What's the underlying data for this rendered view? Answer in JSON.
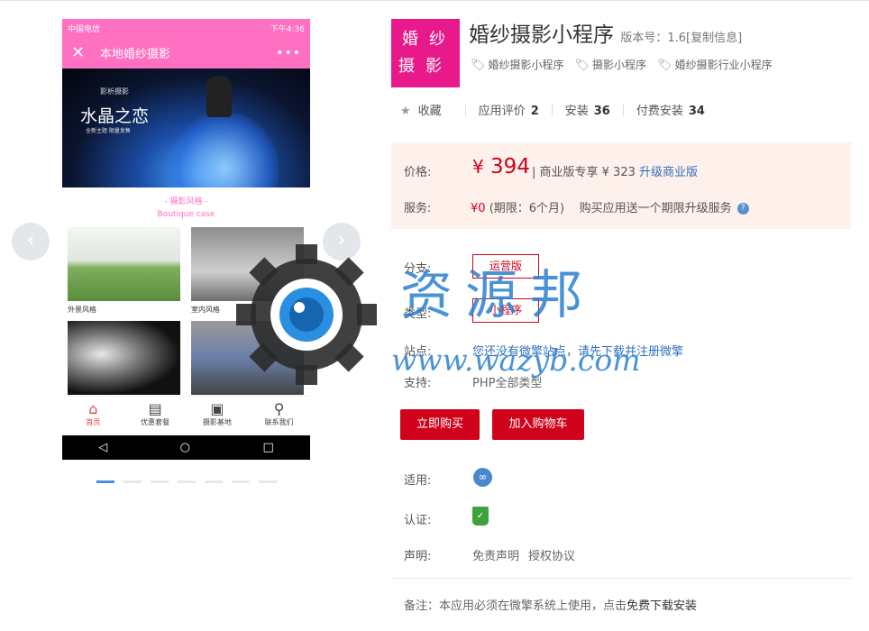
{
  "preview": {
    "status_left": "中国电信",
    "status_right": "下午4:36",
    "nav_title": "本地婚纱摄影",
    "more": "•••",
    "close": "✕",
    "banner_brand": "影析摄影",
    "banner_title": "水晶之恋",
    "banner_sub": "全新主题 限量发售",
    "section_cn": "- 摄影风格 -",
    "section_en": "Boutique case",
    "cells": [
      {
        "caption": "外景风格"
      },
      {
        "caption": "室内风格"
      },
      {
        "caption": ""
      },
      {
        "caption": ""
      }
    ],
    "tabs": [
      {
        "label": "首页",
        "icon": "⌂"
      },
      {
        "label": "优惠套餐",
        "icon": "▤"
      },
      {
        "label": "摄影基地",
        "icon": "▣"
      },
      {
        "label": "联系我们",
        "icon": "⚲"
      }
    ],
    "android": {
      "back": "◁",
      "home": "○",
      "recent": "□"
    },
    "prev_arrow": "‹",
    "next_arrow": "›",
    "slide_count": 7,
    "active_slide": 0
  },
  "product": {
    "logo_text": "婚纱摄影",
    "title": "婚纱摄影小程序",
    "version_label": "版本号：",
    "version": "1.6",
    "copy_info": "[复制信息]",
    "tags": [
      "婚纱摄影小程序",
      "摄影小程序",
      "婚纱摄影行业小程序"
    ],
    "fav_label": "收藏",
    "rating_label": "应用评价",
    "rating_value": "2",
    "install_label": "安装",
    "install_value": "36",
    "paid_install_label": "付费安装",
    "paid_install_value": "34"
  },
  "pricing": {
    "price_label": "价格:",
    "currency": "¥",
    "price": "394",
    "business_text": "| 商业版专享 ¥ 323",
    "upgrade_link": "升级商业版",
    "service_label": "服务:",
    "service_price": "¥0",
    "service_period": "(期限：6个月)",
    "service_desc": "购买应用送一个期限升级服务",
    "help": "?"
  },
  "options": {
    "branch_label": "分支:",
    "branch_value": "运营版",
    "type_label": "类型:",
    "type_value": "小程序",
    "site_label": "站点:",
    "site_text": "您还没有微擎站点，请先下载并注册微擎",
    "support_label": "支持:",
    "support_value": "PHP全部类型"
  },
  "actions": {
    "buy_now": "立即购买",
    "add_cart": "加入购物车"
  },
  "meta": {
    "apply_label": "适用:",
    "cert_label": "认证:",
    "decl_label": "声明:",
    "disclaimer": "免责声明",
    "license": "授权协议",
    "note_prefix": "备注：本应用必须在微擎系统上使用，点击",
    "note_link": "免费下载安装"
  },
  "watermark": {
    "text": "资源邦",
    "url": "www.wazyb.com"
  }
}
